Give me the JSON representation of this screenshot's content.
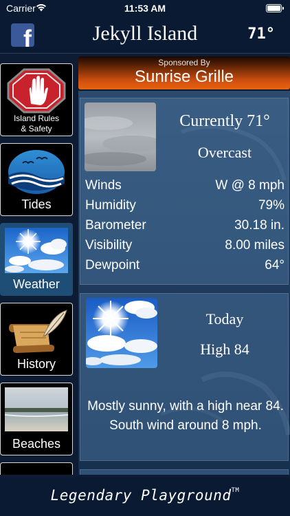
{
  "status_bar": {
    "carrier": "Carrier",
    "time": "11:53 AM",
    "wifi_icon": "wifi-icon",
    "battery_level_fraction": 1.0
  },
  "header": {
    "facebook_icon": "facebook-icon",
    "title": "Jekyll Island",
    "temperature": "71°"
  },
  "sidebar": {
    "items": [
      {
        "label": "Island Rules & Safety",
        "icon": "stop-hand-icon",
        "active": false
      },
      {
        "label": "Tides",
        "icon": "waves-birds-icon",
        "active": false
      },
      {
        "label": "Weather",
        "icon": "sun-clouds-icon",
        "active": true
      },
      {
        "label": "History",
        "icon": "scroll-quill-icon",
        "active": false
      },
      {
        "label": "Beaches",
        "icon": "beach-photo-icon",
        "active": false
      }
    ]
  },
  "sponsor": {
    "caption": "Sponsored By",
    "name": "Sunrise Grille"
  },
  "current": {
    "title": "Currently 71°",
    "condition": "Overcast",
    "rows": [
      {
        "label": "Winds",
        "value": "W @ 8 mph"
      },
      {
        "label": "Humidity",
        "value": "79%"
      },
      {
        "label": "Barometer",
        "value": "30.18 in."
      },
      {
        "label": "Visibility",
        "value": "8.00 miles"
      },
      {
        "label": "Dewpoint",
        "value": "64°"
      }
    ]
  },
  "forecast": {
    "period": "Today",
    "high": "High 84",
    "text": "Mostly sunny, with a high near 84. South wind around 8 mph."
  },
  "footer": {
    "tagline": "Legendary Playground",
    "trademark": "TM"
  },
  "colors": {
    "background": "#0a1a33",
    "active_tile": "#1e4e76",
    "sponsor_gradient_end": "#e8640f",
    "facebook_blue": "#3b5998"
  }
}
